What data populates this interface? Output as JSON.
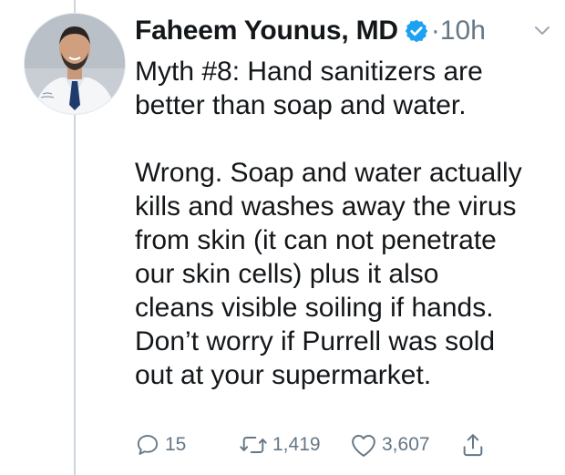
{
  "tweet": {
    "author_name": "Faheem Younus, MD",
    "separator": "·",
    "time": "10h",
    "lines_para1": [
      "Myth #8: Hand sanitizers are",
      "better than soap and water."
    ],
    "lines_para2": [
      "Wrong. Soap and water actually",
      "kills and washes away the virus",
      "from skin (it can not penetrate",
      "our skin cells) plus it also",
      "cleans visible soiling if hands.",
      "Don’t worry if Purrell was sold",
      "out at your supermarket."
    ]
  },
  "actions": {
    "reply_count": "15",
    "retweet_count": "1,419",
    "like_count": "3,607"
  },
  "icons": {
    "verified": "verified-badge-icon",
    "caret": "chevron-down-icon",
    "reply": "reply-icon",
    "retweet": "retweet-icon",
    "like": "heart-icon",
    "share": "share-icon"
  },
  "colors": {
    "verified_blue": "#1da1f2",
    "muted_gray": "#657786",
    "text": "#14171a"
  }
}
